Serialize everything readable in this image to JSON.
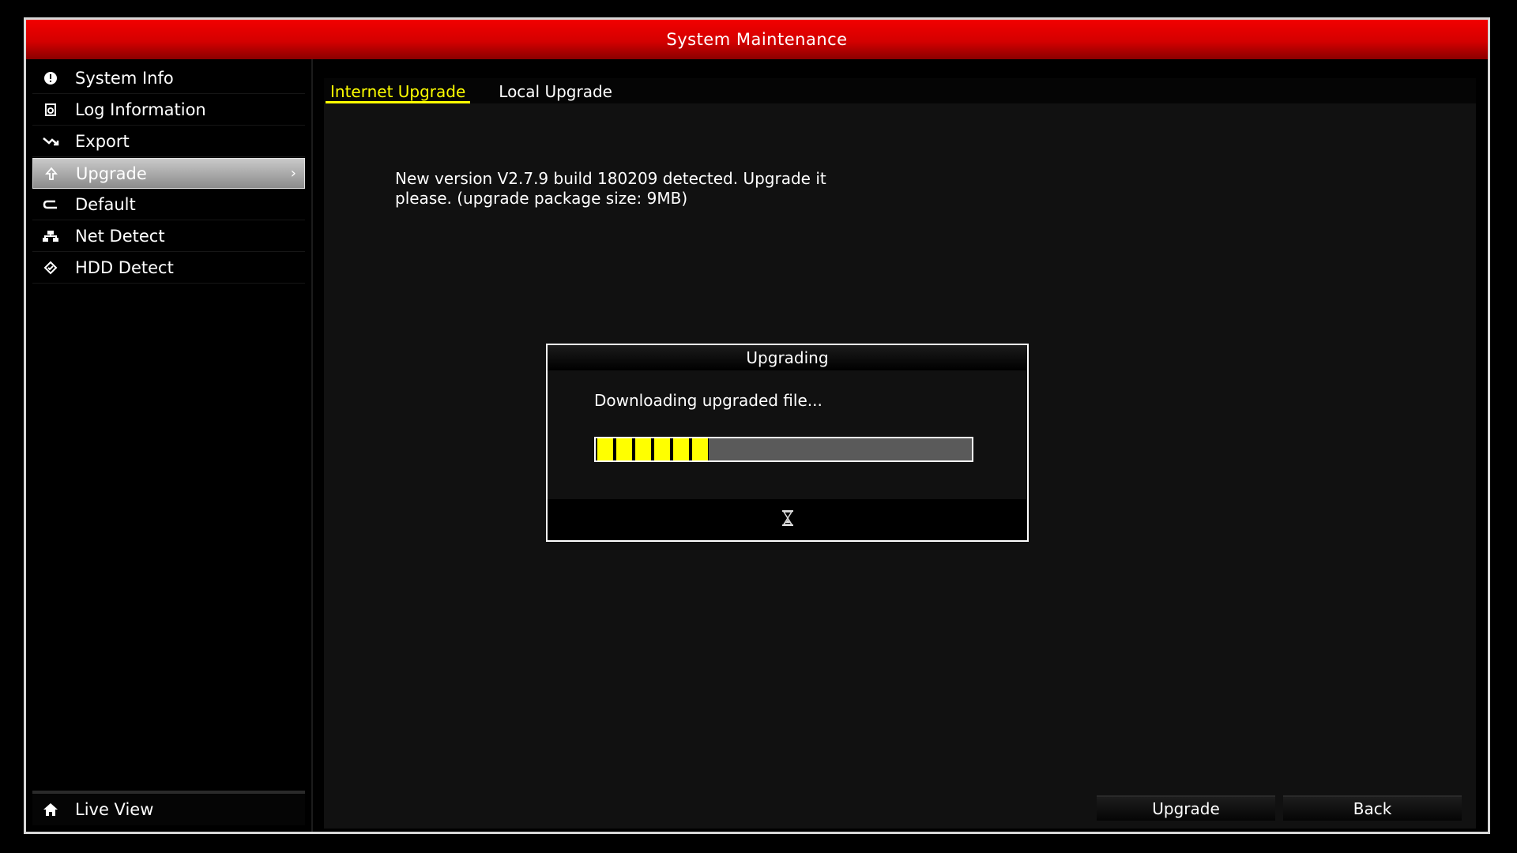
{
  "window": {
    "title": "System Maintenance"
  },
  "sidebar": {
    "items": [
      {
        "label": "System Info",
        "icon": "info-icon"
      },
      {
        "label": "Log Information",
        "icon": "log-icon"
      },
      {
        "label": "Export",
        "icon": "export-icon"
      },
      {
        "label": "Upgrade",
        "icon": "upgrade-icon",
        "active": true
      },
      {
        "label": "Default",
        "icon": "default-icon"
      },
      {
        "label": "Net Detect",
        "icon": "network-icon"
      },
      {
        "label": "HDD Detect",
        "icon": "hdd-detect-icon"
      }
    ],
    "live_view": "Live View"
  },
  "tabs": [
    {
      "label": "Internet Upgrade",
      "active": true
    },
    {
      "label": "Local Upgrade",
      "active": false
    }
  ],
  "main": {
    "message_line1": "New version V2.7.9 build 180209 detected. Upgrade it",
    "message_line2": "please. (upgrade package size:   9MB)"
  },
  "dialog": {
    "title": "Upgrading",
    "message": "Downloading upgraded file...",
    "progress_percent": 30
  },
  "buttons": {
    "upgrade": "Upgrade",
    "back": "Back"
  },
  "colors": {
    "title_red": "#e00000",
    "active_tab": "#ffff00",
    "progress_fill": "#ffff00"
  }
}
